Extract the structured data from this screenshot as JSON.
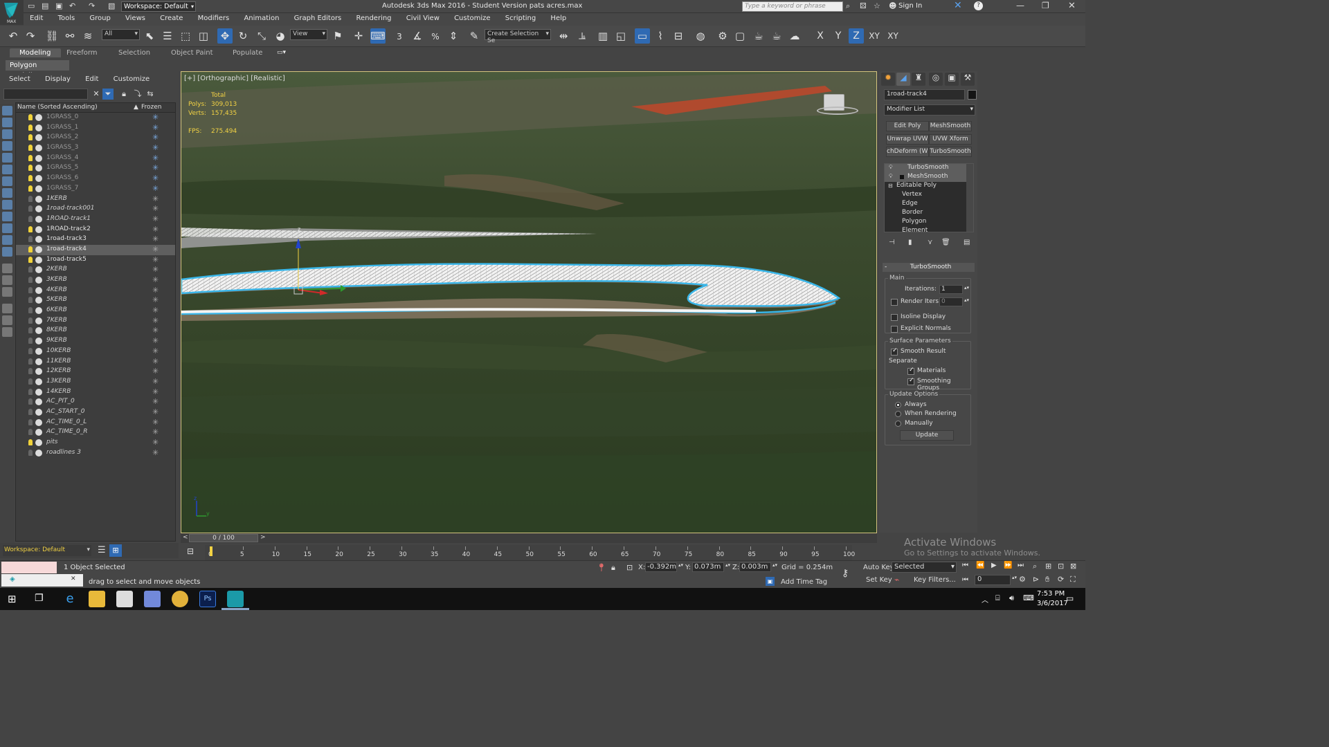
{
  "window": {
    "workspace": "Workspace: Default",
    "title": "Autodesk 3ds Max 2016 - Student Version    pats acres.max",
    "search_placeholder": "Type a keyword or phrase",
    "sign_in": "Sign In"
  },
  "menu": [
    "Edit",
    "Tools",
    "Group",
    "Views",
    "Create",
    "Modifiers",
    "Animation",
    "Graph Editors",
    "Rendering",
    "Civil View",
    "Customize",
    "Scripting",
    "Help"
  ],
  "toolbar": {
    "filter": "All",
    "ref_coord": "View",
    "selection_set": "Create Selection Se",
    "axes": {
      "x": "X",
      "y": "Y",
      "z": "Z",
      "xy": "XY",
      "xy2": "XY"
    },
    "snap3": "3",
    "pct": "%"
  },
  "ribbon": {
    "tabs": [
      "Modeling",
      "Freeform",
      "Selection",
      "Object Paint",
      "Populate"
    ],
    "sub": "Polygon Modeling"
  },
  "scene_explorer": {
    "menu": [
      "Select",
      "Display",
      "Edit",
      "Customize"
    ],
    "col_name": "Name (Sorted Ascending)",
    "col_frozen": "Frozen",
    "rows": [
      {
        "name": "1GRASS_0",
        "bulb": true,
        "style": "gray",
        "frozen": true
      },
      {
        "name": "1GRASS_1",
        "bulb": true,
        "style": "gray",
        "frozen": true
      },
      {
        "name": "1GRASS_2",
        "bulb": true,
        "style": "gray",
        "frozen": true
      },
      {
        "name": "1GRASS_3",
        "bulb": true,
        "style": "gray",
        "frozen": true
      },
      {
        "name": "1GRASS_4",
        "bulb": true,
        "style": "gray",
        "frozen": true
      },
      {
        "name": "1GRASS_5",
        "bulb": true,
        "style": "gray",
        "frozen": true
      },
      {
        "name": "1GRASS_6",
        "bulb": true,
        "style": "gray",
        "frozen": true
      },
      {
        "name": "1GRASS_7",
        "bulb": true,
        "style": "gray",
        "frozen": true
      },
      {
        "name": "1KERB",
        "bulb": false,
        "style": "italic",
        "frozen": false
      },
      {
        "name": "1road-track001",
        "bulb": false,
        "style": "italic",
        "frozen": false
      },
      {
        "name": "1ROAD-track1",
        "bulb": false,
        "style": "italic",
        "frozen": false
      },
      {
        "name": "1ROAD-track2",
        "bulb": true,
        "style": "white",
        "frozen": false
      },
      {
        "name": "1road-track3",
        "bulb": false,
        "style": "white",
        "frozen": false
      },
      {
        "name": "1road-track4",
        "bulb": true,
        "style": "white",
        "frozen": false,
        "selected": true
      },
      {
        "name": "1road-track5",
        "bulb": true,
        "style": "white",
        "frozen": false
      },
      {
        "name": "2KERB",
        "bulb": false,
        "style": "italic",
        "frozen": false
      },
      {
        "name": "3KERB",
        "bulb": false,
        "style": "italic",
        "frozen": false
      },
      {
        "name": "4KERB",
        "bulb": false,
        "style": "italic",
        "frozen": false
      },
      {
        "name": "5KERB",
        "bulb": false,
        "style": "italic",
        "frozen": false
      },
      {
        "name": "6KERB",
        "bulb": false,
        "style": "italic",
        "frozen": false
      },
      {
        "name": "7KERB",
        "bulb": false,
        "style": "italic",
        "frozen": false
      },
      {
        "name": "8KERB",
        "bulb": false,
        "style": "italic",
        "frozen": false
      },
      {
        "name": "9KERB",
        "bulb": false,
        "style": "italic",
        "frozen": false
      },
      {
        "name": "10KERB",
        "bulb": false,
        "style": "italic",
        "frozen": false
      },
      {
        "name": "11KERB",
        "bulb": false,
        "style": "italic",
        "frozen": false
      },
      {
        "name": "12KERB",
        "bulb": false,
        "style": "italic",
        "frozen": false
      },
      {
        "name": "13KERB",
        "bulb": false,
        "style": "italic",
        "frozen": false
      },
      {
        "name": "14KERB",
        "bulb": false,
        "style": "italic",
        "frozen": false
      },
      {
        "name": "AC_PIT_0",
        "bulb": false,
        "style": "italic",
        "frozen": false
      },
      {
        "name": "AC_START_0",
        "bulb": false,
        "style": "italic",
        "frozen": false
      },
      {
        "name": "AC_TIME_0_L",
        "bulb": false,
        "style": "italic",
        "frozen": false
      },
      {
        "name": "AC_TIME_0_R",
        "bulb": false,
        "style": "italic",
        "frozen": false
      },
      {
        "name": "pits",
        "bulb": true,
        "style": "italic",
        "frozen": false
      },
      {
        "name": "roadlines 3",
        "bulb": false,
        "style": "italic",
        "frozen": false
      }
    ],
    "workspace": "Workspace: Default"
  },
  "viewport": {
    "label": "[+] [Orthographic] [Realistic]",
    "stats": {
      "total": "Total",
      "polys_label": "Polys:",
      "polys": "309,013",
      "verts_label": "Verts:",
      "verts": "157,435",
      "fps_label": "FPS:",
      "fps": "275.494"
    },
    "gizmo": {
      "z": "z"
    },
    "axis_tripod": {
      "z": "z",
      "y": "y"
    }
  },
  "command_panel": {
    "object_name": "1road-track4",
    "modifier_list": "Modifier List",
    "buttons": [
      "Edit Poly",
      "MeshSmooth",
      "Unwrap UVW",
      "UVW Xform",
      "chDeform (WS",
      "TurboSmooth"
    ],
    "stack": [
      "TurboSmooth",
      "MeshSmooth",
      "Editable Poly",
      "Vertex",
      "Edge",
      "Border",
      "Polygon",
      "Element"
    ],
    "rollout": {
      "title": "TurboSmooth",
      "main": "Main",
      "iterations_label": "Iterations:",
      "iterations": "1",
      "render_iters_label": "Render Iters:",
      "render_iters": "0",
      "isoline": "Isoline Display",
      "explicit": "Explicit Normals",
      "surface": "Surface Parameters",
      "smooth_result": "Smooth Result",
      "separate": "Separate",
      "materials": "Materials",
      "smoothing_groups": "Smoothing Groups",
      "update_options": "Update Options",
      "always": "Always",
      "when_rendering": "When Rendering",
      "manually": "Manually",
      "update": "Update"
    }
  },
  "time": {
    "slider": "0 / 100",
    "prev": "<",
    "next": ">",
    "ticks": [
      "0",
      "5",
      "10",
      "15",
      "20",
      "25",
      "30",
      "35",
      "40",
      "45",
      "50",
      "55",
      "60",
      "65",
      "70",
      "75",
      "80",
      "85",
      "90",
      "95",
      "100"
    ]
  },
  "status": {
    "selected": "1 Object Selected",
    "prompt": "drag to select and move objects",
    "x_label": "X:",
    "x": "-0.392m",
    "y_label": "Y:",
    "y": "0.073m",
    "z_label": "Z:",
    "z": "0.003m",
    "grid": "Grid = 0.254m",
    "add_time_tag": "Add Time Tag",
    "auto_key": "Auto Key",
    "set_key": "Set Key",
    "selected_set": "Selected",
    "key_filters": "Key Filters...",
    "frame": "0"
  },
  "watermark": {
    "line1": "Activate Windows",
    "line2": "Go to Settings to activate Windows."
  },
  "taskbar": {
    "time": "7:53 PM",
    "date": "3/6/2017"
  }
}
